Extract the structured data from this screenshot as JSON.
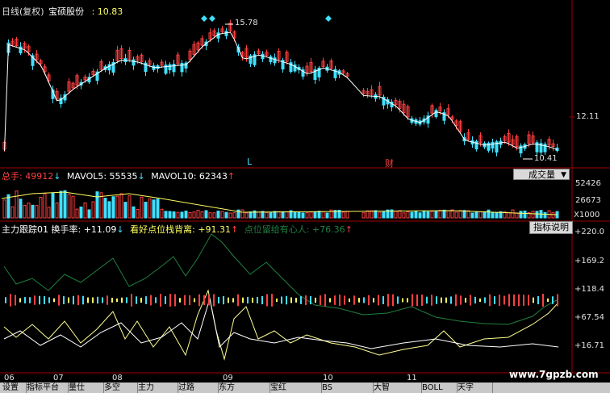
{
  "header": {
    "title": "日线(复权)",
    "stock_name": "宝硕股份",
    "price_label": ": 10.83"
  },
  "price_panel": {
    "high_label": "15.78",
    "low_label": "10.41",
    "y_tick": "12.11",
    "marker_l": "L",
    "marker_cai": "财",
    "colors": {
      "up": "#ff4040",
      "down": "#40e0ff",
      "ma": "#ffffff",
      "ma2": "#ffff60"
    }
  },
  "volume_panel": {
    "label_total": "总手: 49912",
    "label_ma5": "MAVOL5: 55535",
    "label_ma10": "MAVOL10: 62343",
    "dropdown_label": "成交量",
    "y_ticks": [
      "52426",
      "26673",
      "X1000"
    ]
  },
  "indicator_panel": {
    "label_main": "主力跟踪01 换手率: +11.09",
    "label_b": "看好点位栈背离: +91.31",
    "label_c": "点位留给有心人: +76.36",
    "button_label": "指标说明",
    "y_ticks": [
      "+220.0",
      "+169.2",
      "+118.4",
      "+67.54",
      "+16.71"
    ]
  },
  "x_axis": {
    "labels": [
      "06",
      "07",
      "08",
      "09",
      "10",
      "11"
    ]
  },
  "watermark": "www.7gpzb.com",
  "tabs": [
    "设置",
    "指标平台",
    "量仕",
    "多空",
    "主力",
    "过路",
    "东方",
    "宝红",
    "BS",
    "大智",
    "BOLL",
    "天字"
  ]
}
